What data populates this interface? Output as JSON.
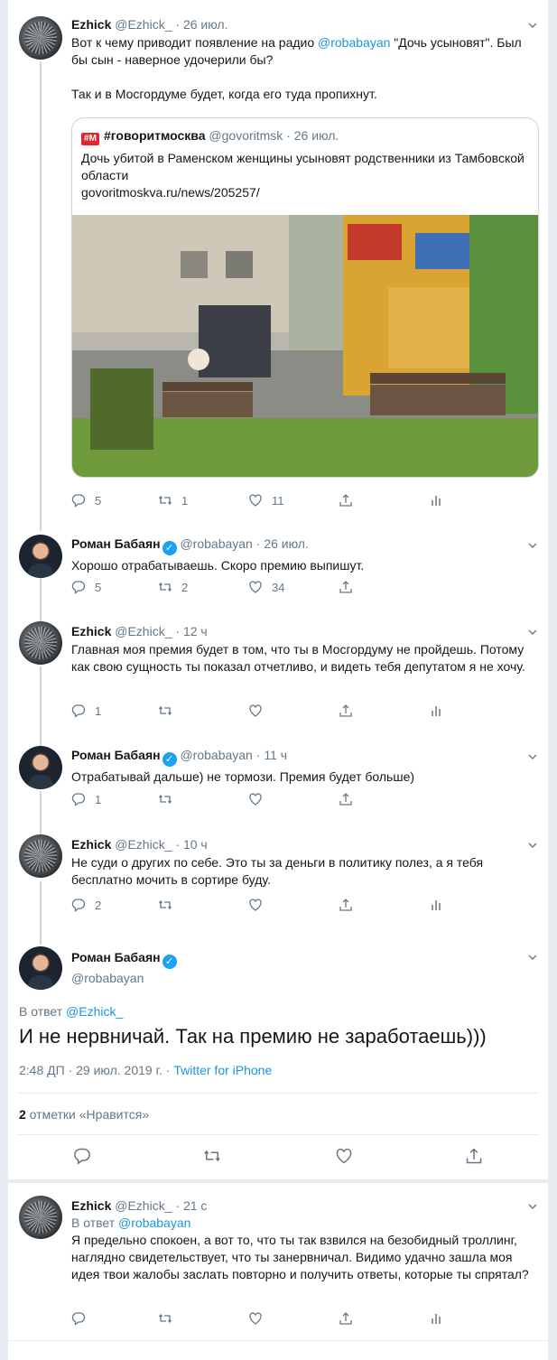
{
  "colors": {
    "link": "#1b95e0",
    "verified": "#1da1f2",
    "secondary": "#657786",
    "border": "#e6ecf0"
  },
  "tweets": [
    {
      "name": "Ezhick",
      "handle": "@Ezhick_",
      "dot": "·",
      "time": "26 июл.",
      "text_pre": "Вот к чему приводит появление на радио ",
      "text_mention": "@robabayan",
      "text_post": " \"Дочь усыновят\". Был бы сын - наверное удочерили бы?",
      "text_2": "Так и в Мосгордуме будет, когда его туда пропихнут.",
      "replies": "5",
      "retweets": "1",
      "likes": "11",
      "quote": {
        "logo": "#M",
        "name": "#говоритмосква",
        "handle": "@govoritmsk",
        "dot": "·",
        "time": "26 июл.",
        "text": "Дочь убитой в Раменском женщины усыновят родственники из Тамбовской области",
        "url": "govoritmoskva.ru/news/205257/"
      }
    },
    {
      "name": "Роман Бабаян",
      "handle": "@robabayan",
      "dot": "·",
      "time": "26 июл.",
      "text": "Хорошо отрабатываешь. Скоро премию выпишут.",
      "replies": "5",
      "retweets": "2",
      "likes": "34"
    },
    {
      "name": "Ezhick",
      "handle": "@Ezhick_",
      "dot": "·",
      "time": "12 ч",
      "text": "Главная моя премия будет в том, что ты в Мосгордуму не пройдешь. Потому как свою сущность ты показал отчетливо, и видеть тебя депутатом я не хочу.",
      "replies": "1",
      "retweets": "",
      "likes": ""
    },
    {
      "name": "Роман Бабаян",
      "handle": "@robabayan",
      "dot": "·",
      "time": "11 ч",
      "text": "Отрабатывай дальше) не тормози. Премия будет больше)",
      "replies": "1",
      "retweets": "",
      "likes": ""
    },
    {
      "name": "Ezhick",
      "handle": "@Ezhick_",
      "dot": "·",
      "time": "10 ч",
      "text": "Не суди о других по себе. Это ты за деньги в политику полез, а я тебя бесплатно мочить в сортире буду.",
      "replies": "2",
      "retweets": "",
      "likes": ""
    }
  ],
  "main": {
    "name": "Роман Бабаян",
    "handle": "@robabayan",
    "reply_prefix": "В ответ ",
    "reply_to": "@Ezhick_",
    "text": "И не нервничай. Так на премию не заработаешь)))",
    "timestamp": "2:48 ДП · 29 июл. 2019 г. · ",
    "source": "Twitter for iPhone",
    "likes_count": "2",
    "likes_label": " отметки «Нравится»"
  },
  "reply": {
    "name": "Ezhick",
    "handle": "@Ezhick_",
    "dot": "·",
    "time": "21 с",
    "reply_prefix": "В ответ ",
    "reply_to": "@robabayan",
    "text": "Я предельно спокоен, а вот то, что ты так взвился на безобидный троллинг, наглядно свидетельствует, что ты занервничал. Видимо удачно зашла моя идея твои жалобы заслать повторно и получить ответы, которые ты спрятал?"
  },
  "icons": [
    "reply-icon",
    "retweet-icon",
    "like-icon",
    "share-icon",
    "analytics-icon",
    "verified-icon",
    "chevron-down-icon"
  ]
}
